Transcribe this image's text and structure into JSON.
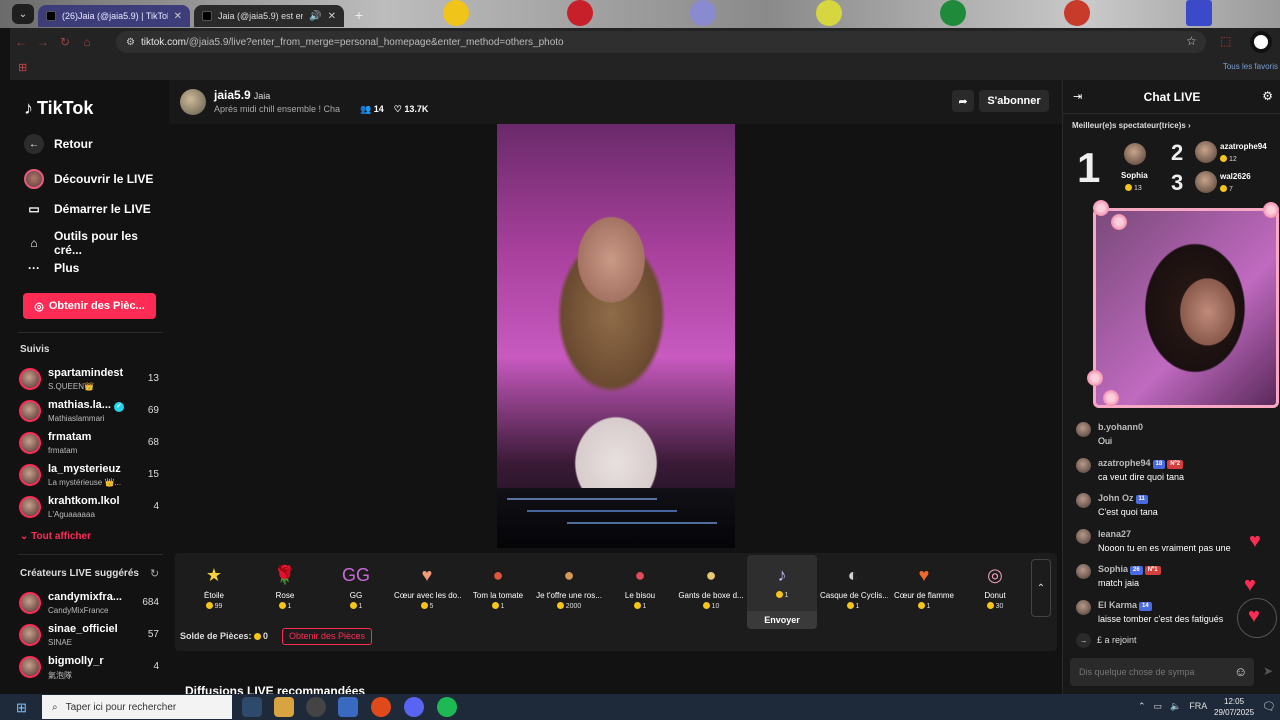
{
  "browser": {
    "tabs": [
      {
        "title": "(26)Jaia (@jaia5.9) | TikTok"
      },
      {
        "title": "Jaia (@jaia5.9) est en LIVE"
      }
    ],
    "url_host": "tiktok.com",
    "url_path": "/@jaia5.9/live?enter_from_merge=personal_homepage&enter_method=others_photo",
    "bookmarks_label": "Tous les favoris"
  },
  "sidebar": {
    "logo": "TikTok",
    "back": "Retour",
    "nav": [
      "Découvrir le LIVE",
      "Démarrer le LIVE",
      "Outils pour les cré...",
      "Plus"
    ],
    "get_coins": "Obtenir des Pièc...",
    "followed_title": "Suivis",
    "followed": [
      {
        "name": "spartamindest",
        "sub": "S.QUEEN👑",
        "count": "13"
      },
      {
        "name": "mathias.la...",
        "sub": "Mathiaslammari",
        "count": "69"
      },
      {
        "name": "frmatam",
        "sub": "frmatam",
        "count": "68"
      },
      {
        "name": "la_mysterieuz",
        "sub": "La mystérieuse 👑...",
        "count": "15"
      },
      {
        "name": "krahtkom.lkol",
        "sub": "L'Aguaaaaaa",
        "count": "4"
      }
    ],
    "see_all": "Tout afficher",
    "suggested_title": "Créateurs LIVE suggérés",
    "suggested": [
      {
        "name": "candymixfra...",
        "sub": "CandyMixFrance",
        "count": "684"
      },
      {
        "name": "sinae_officiel",
        "sub": "SINAE",
        "count": "57"
      },
      {
        "name": "bigmolly_r",
        "sub": "氣泡隊",
        "count": "4"
      }
    ]
  },
  "live": {
    "host_name": "jaia5.9",
    "host_nick": "Jaia",
    "title": "Aprés midi chill ensemble ! Cha",
    "viewers": "14",
    "likes": "13.7K",
    "subscribe": "S'abonner"
  },
  "gifts": [
    {
      "name": "Étoile",
      "price": "99",
      "icon": "★",
      "color": "#f2d33a"
    },
    {
      "name": "Rose",
      "price": "1",
      "icon": "🌹",
      "color": "#e8505b"
    },
    {
      "name": "GG",
      "price": "1",
      "icon": "GG",
      "color": "#c76ad8"
    },
    {
      "name": "Cœur avec les do...",
      "price": "5",
      "icon": "♥",
      "color": "#f09a7a"
    },
    {
      "name": "Tom la tomate",
      "price": "1",
      "icon": "●",
      "color": "#e0553a"
    },
    {
      "name": "Je t'offre une ros...",
      "price": "2000",
      "icon": "●",
      "color": "#d69a55"
    },
    {
      "name": "Le bisou",
      "price": "1",
      "icon": "●",
      "color": "#e54a5a"
    },
    {
      "name": "Gants de boxe d...",
      "price": "10",
      "icon": "●",
      "color": "#e8c870"
    },
    {
      "name": "",
      "price": "1",
      "icon": "♪",
      "color": "#c8b0f0",
      "selected": true,
      "action": "Envoyer"
    },
    {
      "name": "Casque de Cyclis...",
      "price": "1",
      "icon": "◐",
      "color": "#d0d0d0"
    },
    {
      "name": "Cœur de flamme",
      "price": "1",
      "icon": "♥",
      "color": "#f06a30"
    },
    {
      "name": "Donut",
      "price": "30",
      "icon": "◎",
      "color": "#f0a0c0"
    }
  ],
  "balance": {
    "label": "Solde de Pièces:",
    "value": "0",
    "button": "Obtenir des Pièces"
  },
  "reco_title": "Diffusions LIVE recommandées",
  "chat": {
    "title": "Chat LIVE",
    "top_title": "Meilleur(e)s spectateur(trice)s",
    "top": [
      {
        "rank": "1",
        "name": "Sophia",
        "coins": "13"
      },
      {
        "rank": "2",
        "name": "azatrophe94",
        "coins": "12"
      },
      {
        "rank": "3",
        "name": "wal2626",
        "coins": "7"
      }
    ],
    "messages": [
      {
        "name": "b.yohann0",
        "badges": [],
        "text": "Oui"
      },
      {
        "name": "azatrophe94",
        "badges": [
          {
            "t": "18",
            "k": "lvl"
          },
          {
            "t": "Nº2",
            "k": "fan"
          }
        ],
        "text": "ca veut dire quoi tana"
      },
      {
        "name": "John Oz",
        "badges": [
          {
            "t": "11",
            "k": "lvl"
          }
        ],
        "text": "C'est quoi tana"
      },
      {
        "name": "leana27",
        "badges": [],
        "text": "Nooon tu en es vraiment pas une"
      },
      {
        "name": "Sophia",
        "badges": [
          {
            "t": "26",
            "k": "lvl"
          },
          {
            "t": "Nº1",
            "k": "fan"
          }
        ],
        "text": "match jaia"
      },
      {
        "name": "El Karma",
        "badges": [
          {
            "t": "14",
            "k": "lvl"
          }
        ],
        "text": "laisse tomber c'est des fatigués"
      }
    ],
    "joined": "£ a rejoint",
    "input_placeholder": "Dis quelque chose de sympa"
  },
  "taskbar": {
    "search_placeholder": "Taper ici pour rechercher",
    "lang": "FRA",
    "time": "12:05",
    "date": "29/07/2025"
  }
}
